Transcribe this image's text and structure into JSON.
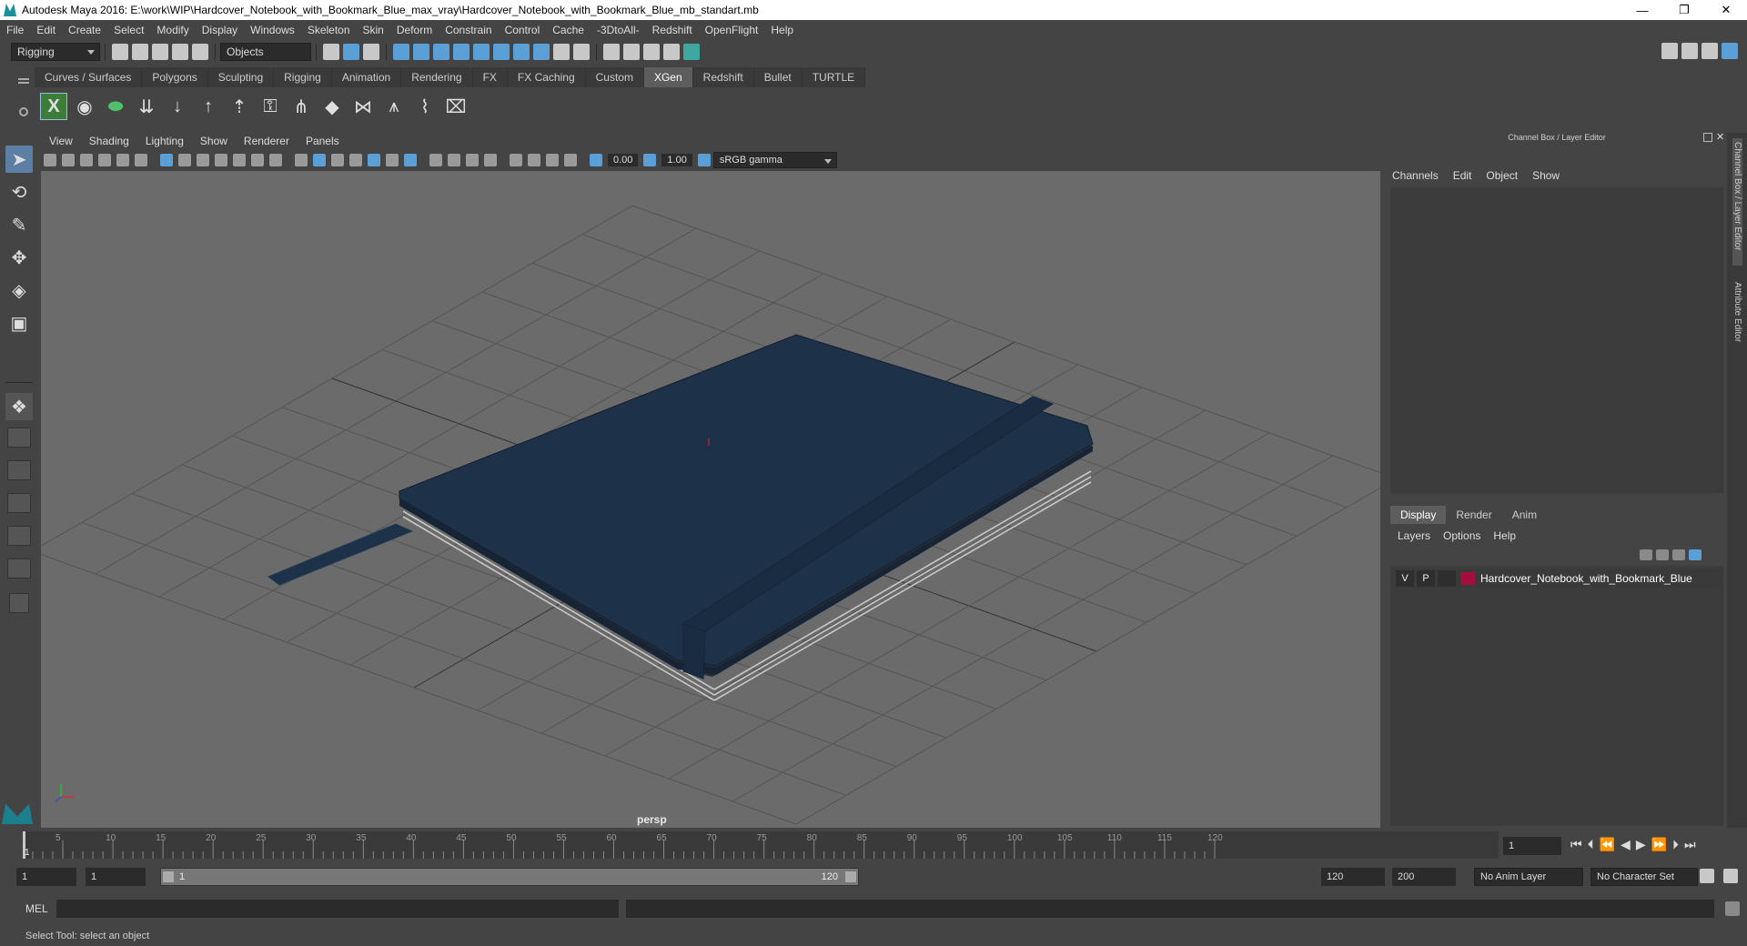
{
  "window": {
    "title": "Autodesk Maya 2016: E:\\work\\WIP\\Hardcover_Notebook_with_Bookmark_Blue_max_vray\\Hardcover_Notebook_with_Bookmark_Blue_mb_standart.mb",
    "minimize": "—",
    "restore": "❐",
    "close": "✕"
  },
  "menubar": [
    "File",
    "Edit",
    "Create",
    "Select",
    "Modify",
    "Display",
    "Windows",
    "Skeleton",
    "Skin",
    "Deform",
    "Constrain",
    "Control",
    "Cache",
    "-3DtoAll-",
    "Redshift",
    "OpenFlight",
    "Help"
  ],
  "statusline": {
    "menuset": "Rigging",
    "select_mode": "Objects"
  },
  "shelf": {
    "tabs": [
      "Curves / Surfaces",
      "Polygons",
      "Sculpting",
      "Rigging",
      "Animation",
      "Rendering",
      "FX",
      "FX Caching",
      "Custom",
      "XGen",
      "Redshift",
      "Bullet",
      "TURTLE"
    ],
    "active_tab": "XGen",
    "icons": [
      "xgen-x-icon",
      "eye-icon",
      "leaf-icon",
      "add-guides-icon",
      "down-arrow-icon",
      "up-arrow-icon",
      "guide-icon",
      "lock-icon",
      "grass-icon",
      "layers-icon",
      "comb-icon",
      "grass-multi-icon",
      "sweep-icon",
      "xgen-preview-icon"
    ]
  },
  "viewport": {
    "menu": [
      "View",
      "Shading",
      "Lighting",
      "Show",
      "Renderer",
      "Panels"
    ],
    "exposure": "0.00",
    "gamma": "1.00",
    "colorspace": "sRGB gamma",
    "camera": "persp"
  },
  "channel_box": {
    "title": "Channel Box / Layer Editor",
    "menu": [
      "Channels",
      "Edit",
      "Object",
      "Show"
    ]
  },
  "layer_editor": {
    "tabs": [
      "Display",
      "Render",
      "Anim"
    ],
    "active_tab": "Display",
    "menu": [
      "Layers",
      "Options",
      "Help"
    ],
    "layers": [
      {
        "visible": "V",
        "playback": "P",
        "color": "#a0103a",
        "name": "Hardcover_Notebook_with_Bookmark_Blue"
      }
    ]
  },
  "side_tabs": [
    "Channel Box / Layer Editor",
    "Attribute Editor"
  ],
  "timeline": {
    "ticks": [
      "5",
      "10",
      "15",
      "20",
      "25",
      "30",
      "35",
      "40",
      "45",
      "50",
      "55",
      "60",
      "65",
      "70",
      "75",
      "80",
      "85",
      "90",
      "95",
      "100",
      "105",
      "110",
      "115",
      "120"
    ],
    "start_label": "1",
    "current_frame": "1"
  },
  "range": {
    "start": "1",
    "playback_start": "1",
    "slider_start": "1",
    "slider_end": "120",
    "playback_end": "120",
    "end": "200",
    "anim_layer": "No Anim Layer",
    "character_set": "No Character Set"
  },
  "command": {
    "label": "MEL"
  },
  "help": {
    "text": "Select Tool: select an object"
  },
  "notebook": {
    "cover_color": "#1d3148",
    "band_color": "#1a2c42"
  }
}
